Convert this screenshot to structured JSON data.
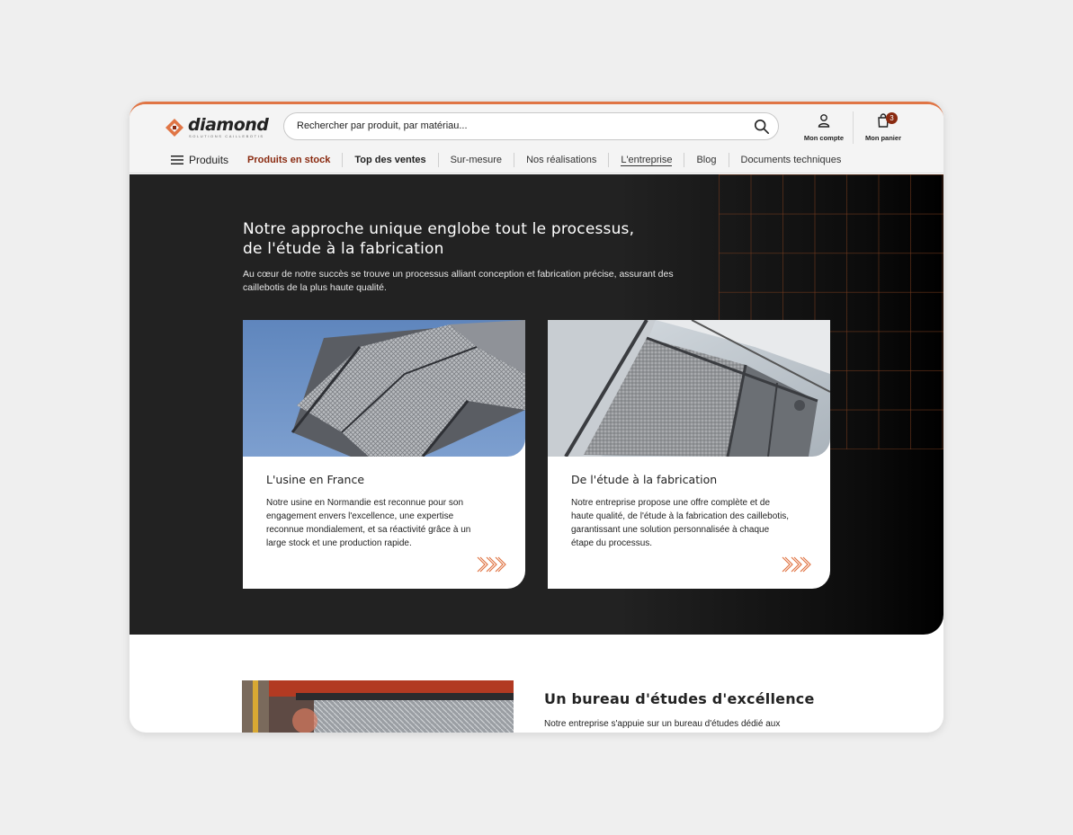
{
  "brand": {
    "name": "diamond",
    "tagline": "SOLUTIONS CAILLEBOTIS",
    "accent": "#e07545",
    "stock_color": "#8a2a10"
  },
  "header": {
    "search_placeholder": "Rechercher par produit, par matériau...",
    "account_label": "Mon compte",
    "cart_label": "Mon panier",
    "cart_count": "3"
  },
  "nav": {
    "menu_label": "Produits",
    "items": [
      {
        "label": "Produits en stock"
      },
      {
        "label": "Top des ventes"
      },
      {
        "label": "Sur-mesure"
      },
      {
        "label": "Nos réalisations"
      },
      {
        "label": "L'entreprise"
      },
      {
        "label": "Blog"
      },
      {
        "label": "Documents techniques"
      }
    ]
  },
  "hero": {
    "title_line1": "Notre approche unique englobe tout le processus,",
    "title_line2": "de l'étude à la fabrication",
    "subtitle": "Au cœur de notre succès se trouve un processus alliant conception et fabrication précise, assurant des caillebotis de la plus haute qualité."
  },
  "cards": [
    {
      "title": "L'usine en France",
      "text": "Notre usine en Normandie est reconnue pour son engagement envers l'excellence, une expertise reconnue mondialement, et sa réactivité grâce à un large stock et une production rapide."
    },
    {
      "title": "De l'étude à la fabrication",
      "text": "Notre entreprise propose une offre complète et de haute qualité, de l'étude à la fabrication des caillebotis, garantissant une solution personnalisée à chaque étape du processus."
    }
  ],
  "section2": {
    "title": "Un bureau d'études d'excéllence",
    "text": "Notre entreprise s'appuie sur un bureau d'études dédié aux"
  }
}
